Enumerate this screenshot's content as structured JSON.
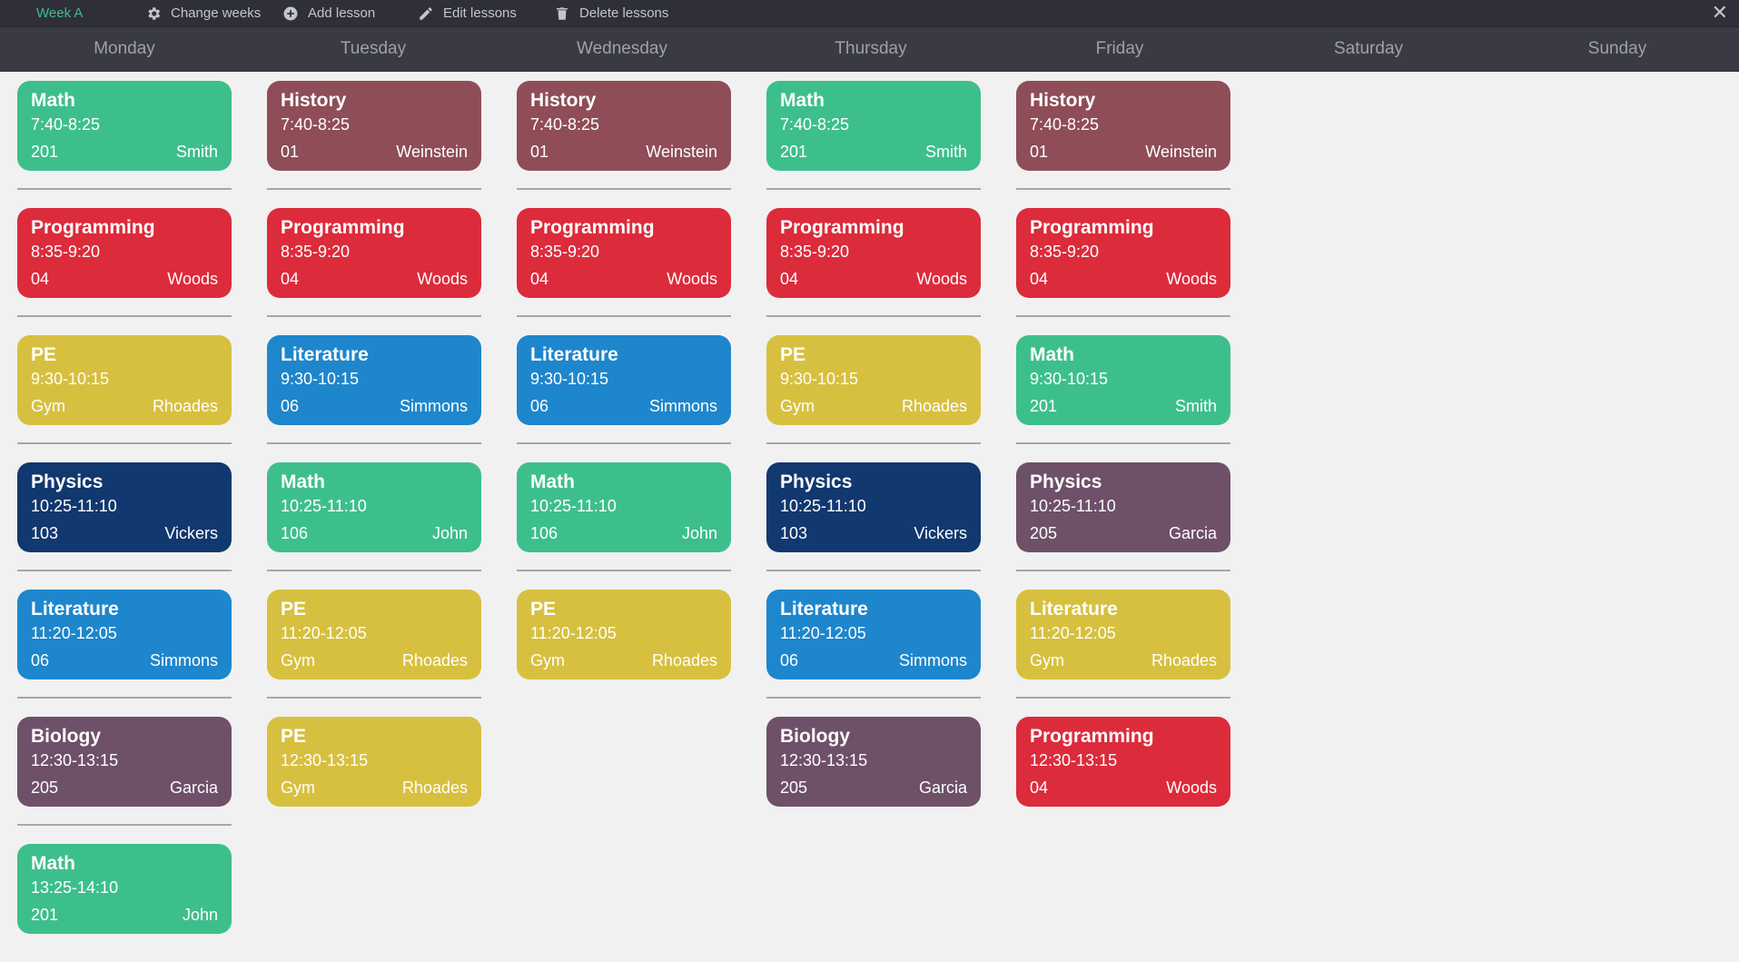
{
  "toolbar": {
    "week_label": "Week A",
    "change_weeks": "Change weeks",
    "add_lesson": "Add lesson",
    "edit_lessons": "Edit lessons",
    "delete_lessons": "Delete lessons",
    "close_glyph": "✕",
    "accent": "#3cbf8d"
  },
  "days": [
    "Monday",
    "Tuesday",
    "Wednesday",
    "Thursday",
    "Friday",
    "Saturday",
    "Sunday"
  ],
  "colors": {
    "green": "#3dbf8c",
    "maroon": "#8f4d57",
    "red": "#dc2b3b",
    "yellow": "#d7c03f",
    "blue": "#1e86cc",
    "navy": "#11386f",
    "purple": "#6e5069"
  },
  "schedule": [
    [
      {
        "subject": "Math",
        "time": "7:40-8:25",
        "room": "201",
        "teacher": "Smith",
        "color": "green"
      },
      {
        "subject": "Programming",
        "time": "8:35-9:20",
        "room": "04",
        "teacher": "Woods",
        "color": "red"
      },
      {
        "subject": "PE",
        "time": "9:30-10:15",
        "room": "Gym",
        "teacher": "Rhoades",
        "color": "yellow"
      },
      {
        "subject": "Physics",
        "time": "10:25-11:10",
        "room": "103",
        "teacher": "Vickers",
        "color": "navy"
      },
      {
        "subject": "Literature",
        "time": "11:20-12:05",
        "room": "06",
        "teacher": "Simmons",
        "color": "blue"
      },
      {
        "subject": "Biology",
        "time": "12:30-13:15",
        "room": "205",
        "teacher": "Garcia",
        "color": "purple"
      },
      {
        "subject": "Math",
        "time": "13:25-14:10",
        "room": "201",
        "teacher": "John",
        "color": "green"
      }
    ],
    [
      {
        "subject": "History",
        "time": "7:40-8:25",
        "room": "01",
        "teacher": "Weinstein",
        "color": "maroon"
      },
      {
        "subject": "Programming",
        "time": "8:35-9:20",
        "room": "04",
        "teacher": "Woods",
        "color": "red"
      },
      {
        "subject": "Literature",
        "time": "9:30-10:15",
        "room": "06",
        "teacher": "Simmons",
        "color": "blue"
      },
      {
        "subject": "Math",
        "time": "10:25-11:10",
        "room": "106",
        "teacher": "John",
        "color": "green"
      },
      {
        "subject": "PE",
        "time": "11:20-12:05",
        "room": "Gym",
        "teacher": "Rhoades",
        "color": "yellow"
      },
      {
        "subject": "PE",
        "time": "12:30-13:15",
        "room": "Gym",
        "teacher": "Rhoades",
        "color": "yellow"
      }
    ],
    [
      {
        "subject": "History",
        "time": "7:40-8:25",
        "room": "01",
        "teacher": "Weinstein",
        "color": "maroon"
      },
      {
        "subject": "Programming",
        "time": "8:35-9:20",
        "room": "04",
        "teacher": "Woods",
        "color": "red"
      },
      {
        "subject": "Literature",
        "time": "9:30-10:15",
        "room": "06",
        "teacher": "Simmons",
        "color": "blue"
      },
      {
        "subject": "Math",
        "time": "10:25-11:10",
        "room": "106",
        "teacher": "John",
        "color": "green"
      },
      {
        "subject": "PE",
        "time": "11:20-12:05",
        "room": "Gym",
        "teacher": "Rhoades",
        "color": "yellow"
      }
    ],
    [
      {
        "subject": "Math",
        "time": "7:40-8:25",
        "room": "201",
        "teacher": "Smith",
        "color": "green"
      },
      {
        "subject": "Programming",
        "time": "8:35-9:20",
        "room": "04",
        "teacher": "Woods",
        "color": "red"
      },
      {
        "subject": "PE",
        "time": "9:30-10:15",
        "room": "Gym",
        "teacher": "Rhoades",
        "color": "yellow"
      },
      {
        "subject": "Physics",
        "time": "10:25-11:10",
        "room": "103",
        "teacher": "Vickers",
        "color": "navy"
      },
      {
        "subject": "Literature",
        "time": "11:20-12:05",
        "room": "06",
        "teacher": "Simmons",
        "color": "blue"
      },
      {
        "subject": "Biology",
        "time": "12:30-13:15",
        "room": "205",
        "teacher": "Garcia",
        "color": "purple"
      }
    ],
    [
      {
        "subject": "History",
        "time": "7:40-8:25",
        "room": "01",
        "teacher": "Weinstein",
        "color": "maroon"
      },
      {
        "subject": "Programming",
        "time": "8:35-9:20",
        "room": "04",
        "teacher": "Woods",
        "color": "red"
      },
      {
        "subject": "Math",
        "time": "9:30-10:15",
        "room": "201",
        "teacher": "Smith",
        "color": "green"
      },
      {
        "subject": "Physics",
        "time": "10:25-11:10",
        "room": "205",
        "teacher": "Garcia",
        "color": "purple"
      },
      {
        "subject": "Literature",
        "time": "11:20-12:05",
        "room": "Gym",
        "teacher": "Rhoades",
        "color": "yellow"
      },
      {
        "subject": "Programming",
        "time": "12:30-13:15",
        "room": "04",
        "teacher": "Woods",
        "color": "red"
      }
    ],
    [],
    []
  ]
}
